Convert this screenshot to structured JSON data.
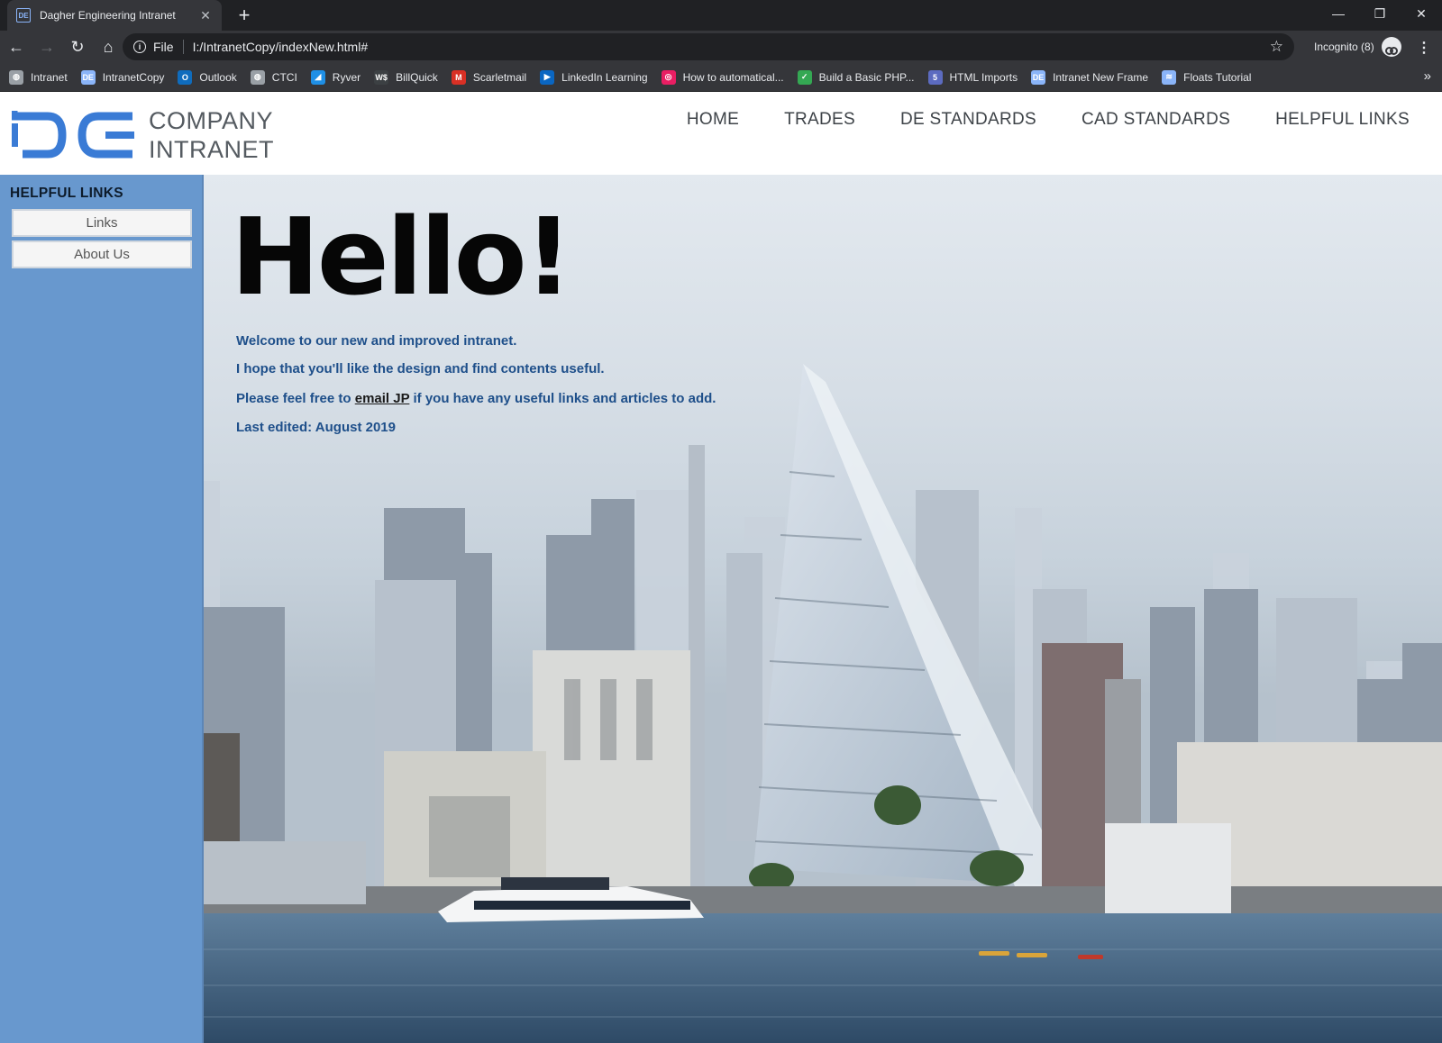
{
  "browser": {
    "tab_title": "Dagher Engineering Intranet",
    "tab_favicon": "DE",
    "url_scheme": "File",
    "url": "I:/IntranetCopy/indexNew.html#",
    "incognito_label": "Incognito (8)",
    "bookmarks": [
      {
        "label": "Intranet",
        "icon": "globe-icon",
        "color": "#9aa0a6"
      },
      {
        "label": "IntranetCopy",
        "icon": "de-logo-icon",
        "color": "#8ab4f8"
      },
      {
        "label": "Outlook",
        "icon": "outlook-icon",
        "color": "#0f6cbd"
      },
      {
        "label": "CTCI",
        "icon": "globe-icon",
        "color": "#9aa0a6"
      },
      {
        "label": "Ryver",
        "icon": "ryver-icon",
        "color": "#1f8fe5"
      },
      {
        "label": "BillQuick",
        "icon": "billquick-icon",
        "color": "#3c4043"
      },
      {
        "label": "Scarletmail",
        "icon": "gmail-icon",
        "color": "#d93025"
      },
      {
        "label": "LinkedIn Learning",
        "icon": "linkedin-learning-icon",
        "color": "#0a66c2"
      },
      {
        "label": "How to automatical...",
        "icon": "swirl-icon",
        "color": "#e91e63"
      },
      {
        "label": "Build a Basic PHP...",
        "icon": "php-icon",
        "color": "#34a853"
      },
      {
        "label": "HTML Imports",
        "icon": "html5-icon",
        "color": "#5c6bc0"
      },
      {
        "label": "Intranet New Frame",
        "icon": "de-logo-icon",
        "color": "#8ab4f8"
      },
      {
        "label": "Floats Tutorial",
        "icon": "floats-icon",
        "color": "#8ab4f8"
      }
    ]
  },
  "site": {
    "logo_mark": "DE",
    "logo_line1": "COMPANY",
    "logo_line2": "INTRANET",
    "nav": [
      "HOME",
      "TRADES",
      "DE STANDARDS",
      "CAD STANDARDS",
      "HELPFUL LINKS"
    ],
    "sidebar": {
      "heading": "HELPFUL LINKS",
      "buttons": [
        "Links",
        "About Us"
      ]
    },
    "hero": {
      "title": "Hello!",
      "line1": "Welcome to our new and improved intranet.",
      "line2": "I hope that you'll like the design and find contents useful.",
      "line3_before": "Please feel free to ",
      "line3_link": "email JP",
      "line3_after": " if you have any useful links and articles to add.",
      "line4": "Last edited: August 2019"
    },
    "colors": {
      "sidebar": "#6898ce",
      "hero_text": "#1e4f8a",
      "logo_blue": "#3a7bd5"
    }
  }
}
